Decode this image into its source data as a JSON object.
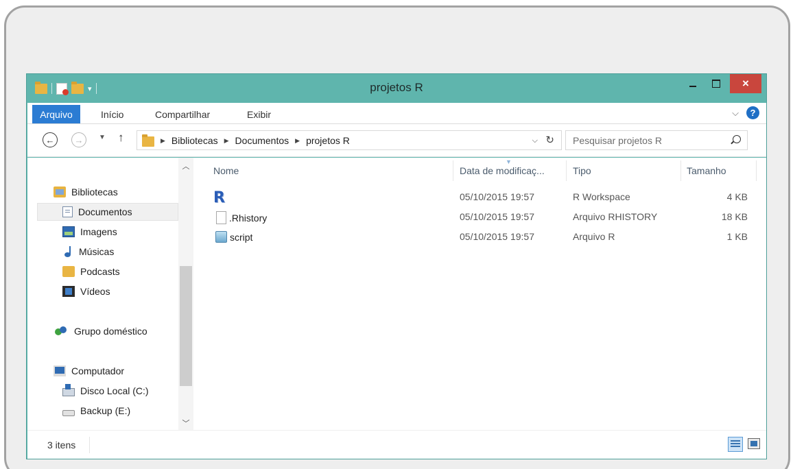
{
  "window": {
    "title": "projetos R",
    "close_label": "×"
  },
  "ribbon": {
    "file_tab": "Arquivo",
    "tabs": [
      "Início",
      "Compartilhar",
      "Exibir"
    ],
    "chevron": "⌵",
    "help": "?"
  },
  "navigation": {
    "breadcrumb": [
      "Bibliotecas",
      "Documentos",
      "projetos R"
    ],
    "search_placeholder": "Pesquisar projetos R"
  },
  "sidebar": {
    "groups": [
      {
        "label": "Bibliotecas",
        "icon": "libraries-icon"
      },
      {
        "label": "Documentos",
        "icon": "documents-icon",
        "selected": true
      },
      {
        "label": "Imagens",
        "icon": "pictures-icon"
      },
      {
        "label": "Músicas",
        "icon": "music-icon"
      },
      {
        "label": "Podcasts",
        "icon": "podcasts-icon"
      },
      {
        "label": "Vídeos",
        "icon": "videos-icon"
      },
      {
        "label": "Grupo doméstico",
        "icon": "homegroup-icon"
      },
      {
        "label": "Computador",
        "icon": "computer-icon"
      },
      {
        "label": "Disco Local (C:)",
        "icon": "local-disk-icon"
      },
      {
        "label": "Backup (E:)",
        "icon": "backup-drive-icon"
      }
    ]
  },
  "file_list": {
    "columns": [
      "Nome",
      "Data de modificaç...",
      "Tipo",
      "Tamanho"
    ],
    "rows": [
      {
        "name": "",
        "icon": "r-workspace-icon",
        "modified": "05/10/2015 19:57",
        "type": "R Workspace",
        "size": "4 KB"
      },
      {
        "name": ".Rhistory",
        "icon": "blank-file-icon",
        "modified": "05/10/2015 19:57",
        "type": "Arquivo RHISTORY",
        "size": "18 KB"
      },
      {
        "name": "script",
        "icon": "r-script-icon",
        "modified": "05/10/2015 19:57",
        "type": "Arquivo R",
        "size": "1 KB"
      }
    ]
  },
  "status": {
    "item_count": "3 itens"
  },
  "colors": {
    "titlebar": "#5fb5ad",
    "file_tab": "#2b7cd3",
    "close_button": "#c9463d"
  }
}
